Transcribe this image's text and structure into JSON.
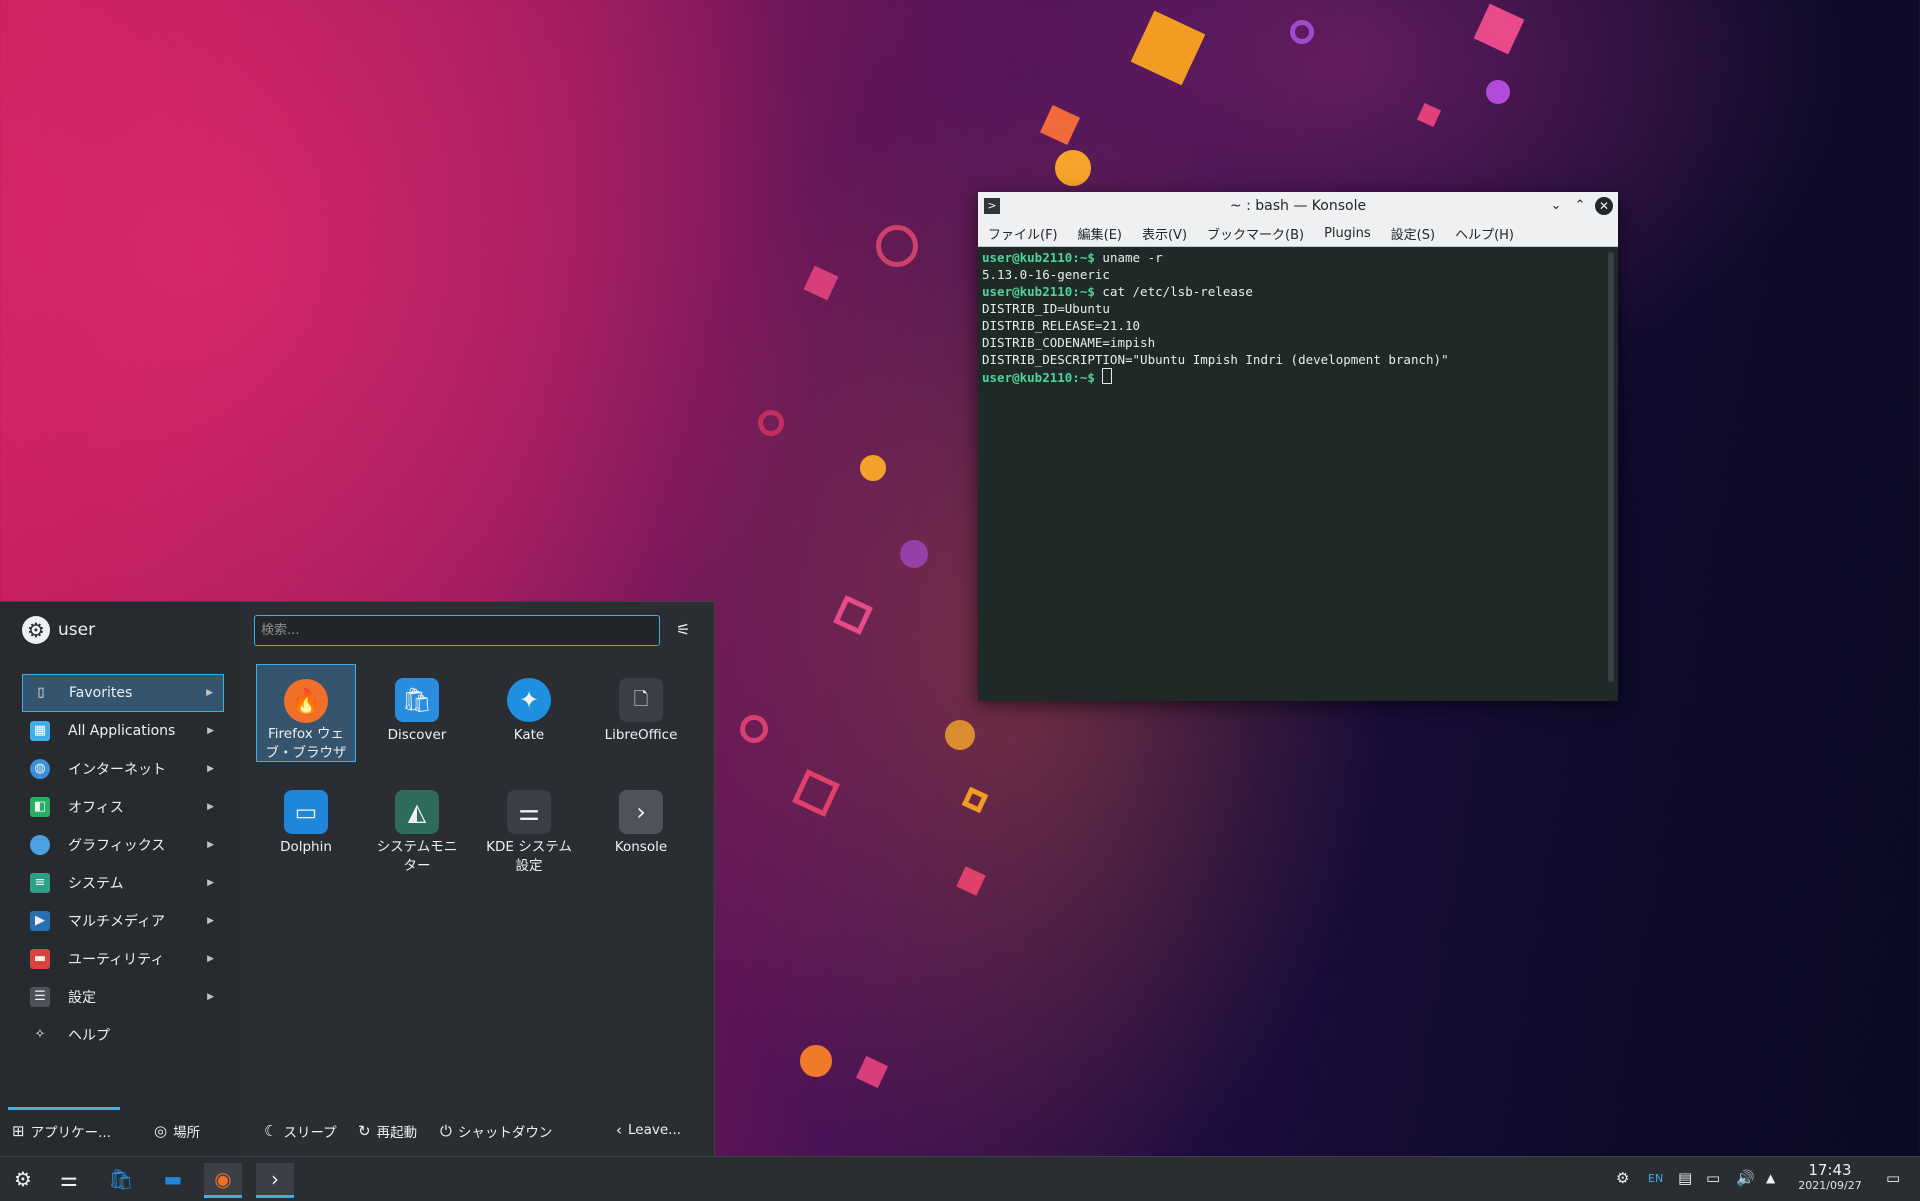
{
  "konsole": {
    "title": "~ : bash — Konsole",
    "menu": [
      "ファイル(F)",
      "編集(E)",
      "表示(V)",
      "ブックマーク(B)",
      "Plugins",
      "設定(S)",
      "ヘルプ(H)"
    ],
    "lines": [
      {
        "prompt": "user@kub2110:~$",
        "text": " uname -r"
      },
      {
        "prompt": "",
        "text": "5.13.0-16-generic"
      },
      {
        "prompt": "user@kub2110:~$",
        "text": " cat /etc/lsb-release"
      },
      {
        "prompt": "",
        "text": "DISTRIB_ID=Ubuntu"
      },
      {
        "prompt": "",
        "text": "DISTRIB_RELEASE=21.10"
      },
      {
        "prompt": "",
        "text": "DISTRIB_CODENAME=impish"
      },
      {
        "prompt": "",
        "text": "DISTRIB_DESCRIPTION=\"Ubuntu Impish Indri (development branch)\""
      },
      {
        "prompt": "user@kub2110:~$",
        "text": " "
      }
    ]
  },
  "launcher": {
    "user_name": "user",
    "search_placeholder": "検索...",
    "categories": [
      {
        "label": "Favorites",
        "icon": "bookmark-icon",
        "color": "#35546e"
      },
      {
        "label": "All Applications",
        "icon": "grid-icon",
        "color": "#3daee9"
      },
      {
        "label": "インターネット",
        "icon": "globe-icon",
        "color": "#3a8fd6"
      },
      {
        "label": "オフィス",
        "icon": "office-icon",
        "color": "#27ae60"
      },
      {
        "label": "グラフィックス",
        "icon": "graphics-icon",
        "color": "#4aa3e0"
      },
      {
        "label": "システム",
        "icon": "system-icon",
        "color": "#2ea08a"
      },
      {
        "label": "マルチメディア",
        "icon": "multimedia-icon",
        "color": "#2a6fb0"
      },
      {
        "label": "ユーティリティ",
        "icon": "utilities-icon",
        "color": "#d9423f"
      },
      {
        "label": "設定",
        "icon": "settings-icon",
        "color": "#4d5359"
      },
      {
        "label": "ヘルプ",
        "icon": "help-icon",
        "color": "#4d5359"
      }
    ],
    "apps": [
      {
        "label": "Firefox ウェ\nブ・ブラウザ",
        "icon": "firefox-icon",
        "color": "#f0702a"
      },
      {
        "label": "Discover",
        "icon": "discover-icon",
        "color": "#2a8ee0"
      },
      {
        "label": "Kate",
        "icon": "kate-icon",
        "color": "#1f8fe0"
      },
      {
        "label": "LibreOffice",
        "icon": "libreoffice-icon",
        "color": "#3c4046"
      },
      {
        "label": "Dolphin",
        "icon": "dolphin-icon",
        "color": "#1e87d9"
      },
      {
        "label": "システムモニ\nター",
        "icon": "system-monitor-icon",
        "color": "#2f6b5a"
      },
      {
        "label": "KDE システム\n設定",
        "icon": "kde-settings-icon",
        "color": "#3c4046"
      },
      {
        "label": "Konsole",
        "icon": "konsole-icon",
        "color": "#4d5359"
      }
    ],
    "bottom": {
      "applications": "アプリケー...",
      "places": "場所",
      "sleep": "スリープ",
      "restart": "再起動",
      "shutdown": "シャットダウン",
      "leave": "Leave..."
    }
  },
  "taskbar": {
    "lang": "EN",
    "time": "17:43",
    "date": "2021/09/27",
    "tasks": [
      "kickoff-icon",
      "settings-sliders-icon",
      "discover-icon",
      "dolphin-icon",
      "firefox-icon",
      "konsole-icon"
    ]
  }
}
